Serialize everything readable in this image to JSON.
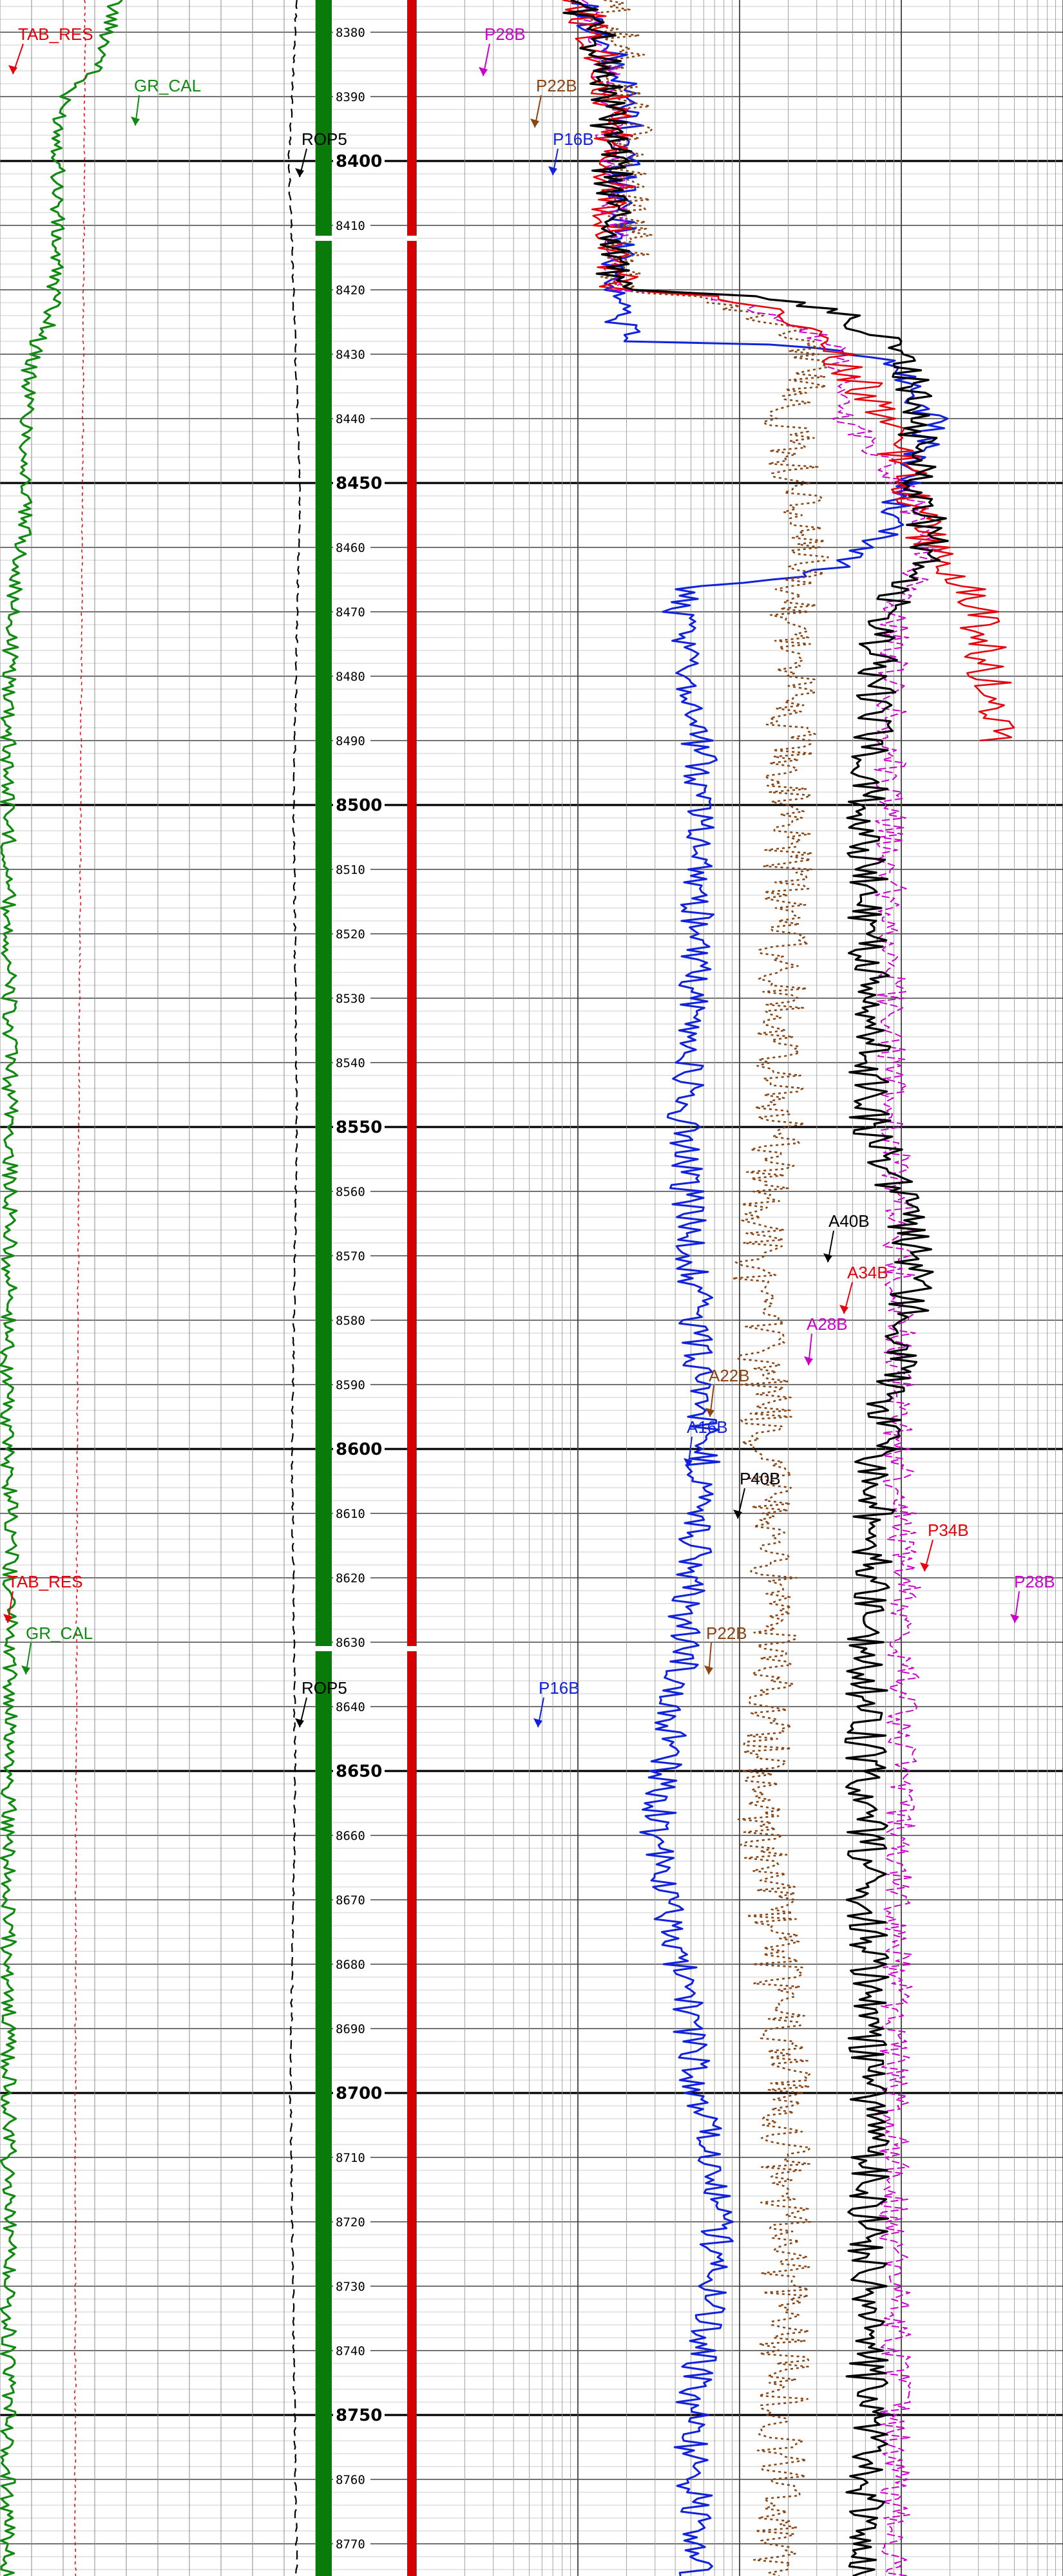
{
  "chart_data": {
    "type": "line",
    "title": "",
    "xlabel": "",
    "ylabel": "",
    "depth_range": [
      8375,
      8775
    ],
    "depth_labels": [
      8380,
      8390,
      8400,
      8410,
      8420,
      8430,
      8440,
      8450,
      8460,
      8470,
      8480,
      8490,
      8500,
      8510,
      8520,
      8530,
      8540,
      8550,
      8560,
      8570,
      8580,
      8590,
      8600,
      8610,
      8620,
      8630,
      8640,
      8650,
      8660,
      8670,
      8680,
      8690,
      8700,
      8710,
      8720,
      8730,
      8740,
      8750,
      8760,
      8770
    ],
    "major_depths": [
      8400,
      8450,
      8500,
      8550,
      8600,
      8650,
      8700,
      8750
    ],
    "grid": true,
    "legend": "none",
    "colors": {
      "tab_res": "#e8000b",
      "gr_cal": "#118a11",
      "rop5": "#000000",
      "p16b": "#1122dd",
      "p22b": "#8b4513",
      "p28b": "#cc00cc",
      "p34b": "#e8000b",
      "p40b": "#000000",
      "depth_track": "#0a7a0a",
      "track_sep": "#d40000"
    },
    "series": [
      {
        "name": "GR_CAL",
        "track": 1,
        "scale": [
          0,
          150
        ],
        "depth": [
          8375,
          8385,
          8390,
          8395,
          8400,
          8410,
          8420,
          8425,
          8428,
          8432,
          8440,
          8450,
          8458,
          8463,
          8468,
          8475,
          8490,
          8520,
          8550,
          8580,
          8600,
          8610,
          8618,
          8622,
          8630,
          8660,
          8700,
          8740,
          8775
        ],
        "values": [
          55,
          48,
          30,
          28,
          28,
          27,
          26,
          24,
          18,
          14,
          13,
          12,
          11,
          9,
          6,
          5,
          4,
          4,
          5,
          4,
          3,
          6,
          5,
          5,
          5,
          4,
          4,
          4,
          4
        ]
      },
      {
        "name": "TAB_RES",
        "track": 1,
        "scale": [
          0.2,
          2000
        ],
        "depth": [
          8375,
          8500,
          8600,
          8700,
          8775
        ],
        "values": [
          2.4,
          2.1,
          1.9,
          1.8,
          1.8
        ]
      },
      {
        "name": "ROP5",
        "track": 1,
        "scale": [
          0,
          200
        ],
        "depth": [
          8375,
          8400,
          8450,
          8500,
          8550,
          8600,
          8650,
          8700,
          8775
        ],
        "values": [
          188,
          183,
          190,
          186,
          188,
          185,
          187,
          184,
          188
        ]
      },
      {
        "name": "P16B",
        "track": 2,
        "scale": [
          0.2,
          2000
        ],
        "depth": [
          8375,
          8390,
          8400,
          8420,
          8428,
          8432,
          8440,
          8458,
          8462,
          8466,
          8470,
          8480,
          8500,
          8550,
          8600,
          8640,
          8660,
          8700,
          8720,
          8750,
          8775
        ],
        "values": [
          2,
          4,
          4,
          3.5,
          4,
          200,
          300,
          150,
          100,
          10,
          8,
          10,
          12,
          9,
          12,
          8,
          6,
          11,
          15,
          10,
          11
        ]
      },
      {
        "name": "P22B",
        "track": 2,
        "scale": [
          0.2,
          2000
        ],
        "depth": [
          8375,
          8390,
          8420,
          8430,
          8440,
          8460,
          8470,
          8500,
          8550,
          8570,
          8600,
          8620,
          8660,
          8700,
          8775
        ],
        "values": [
          3,
          4,
          4,
          60,
          40,
          50,
          45,
          40,
          35,
          25,
          30,
          32,
          28,
          40,
          35
        ]
      },
      {
        "name": "P28B",
        "track": 2,
        "scale": [
          0.2,
          2000
        ],
        "depth": [
          8375,
          8385,
          8420,
          8430,
          8440,
          8460,
          8470,
          8500,
          8550,
          8580,
          8600,
          8620,
          8700,
          8775
        ],
        "values": [
          2,
          3,
          3.5,
          80,
          90,
          300,
          180,
          170,
          180,
          200,
          190,
          210,
          180,
          185
        ]
      },
      {
        "name": "P34B",
        "track": 2,
        "scale": [
          0.2,
          2000
        ],
        "depth": [
          8375,
          8385,
          8420,
          8430,
          8440,
          8460,
          8470,
          8490
        ],
        "values": [
          2,
          3,
          3.5,
          80,
          150,
          300,
          600,
          800
        ]
      },
      {
        "name": "P40B",
        "track": 2,
        "scale": [
          0.2,
          2000
        ],
        "depth": [
          8375,
          8385,
          8420,
          8430,
          8440,
          8460,
          8470,
          8500,
          8550,
          8570,
          8600,
          8640,
          8700,
          8775
        ],
        "values": [
          2,
          3,
          3.5,
          200,
          250,
          300,
          150,
          120,
          130,
          250,
          140,
          120,
          125,
          120
        ]
      }
    ],
    "annotations": [
      {
        "text": "TAB_RES",
        "color": "#e8000b"
      },
      {
        "text": "GR_CAL",
        "color": "#118a11"
      },
      {
        "text": "ROP5",
        "color": "#000000"
      },
      {
        "text": "P28B",
        "color": "#cc00cc"
      },
      {
        "text": "P22B",
        "color": "#8b4513"
      },
      {
        "text": "P16B",
        "color": "#1122dd"
      },
      {
        "text": "A40B",
        "color": "#000000"
      },
      {
        "text": "A34B",
        "color": "#e8000b"
      },
      {
        "text": "A28B",
        "color": "#cc00cc"
      },
      {
        "text": "A22B",
        "color": "#8b4513"
      },
      {
        "text": "A16B",
        "color": "#1122dd"
      },
      {
        "text": "P40B",
        "color": "#000000"
      },
      {
        "text": "P34B",
        "color": "#e8000b"
      },
      {
        "text": "P28B",
        "color": "#cc00cc"
      },
      {
        "text": "TAB_RES",
        "color": "#e8000b"
      },
      {
        "text": "GR_CAL",
        "color": "#118a11"
      },
      {
        "text": "P22B",
        "color": "#8b4513"
      },
      {
        "text": "ROP5",
        "color": "#000000"
      },
      {
        "text": "P16B",
        "color": "#1122dd"
      }
    ]
  }
}
